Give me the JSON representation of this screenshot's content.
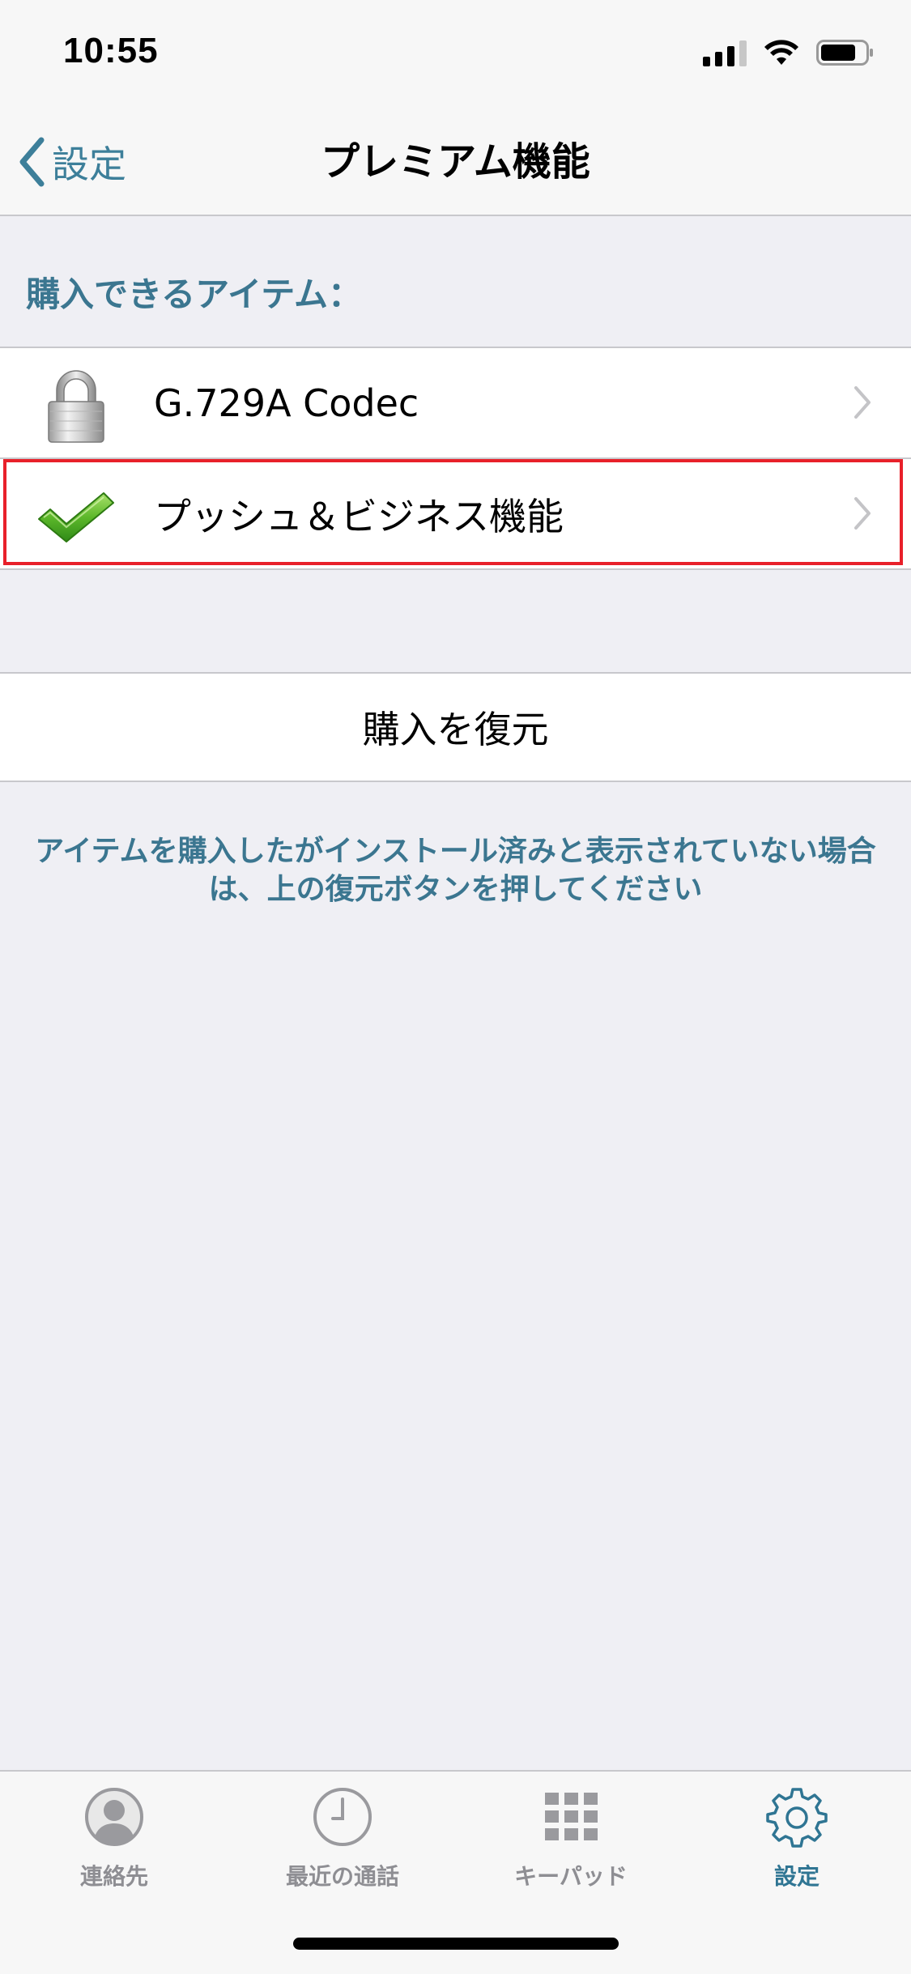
{
  "status_bar": {
    "time": "10:55",
    "icons": [
      "cellular-signal-icon",
      "wifi-icon",
      "battery-icon"
    ]
  },
  "nav": {
    "back_label": "設定",
    "title": "プレミアム機能"
  },
  "section": {
    "header": "購入できるアイテム："
  },
  "items": [
    {
      "label": "G.729A Codec",
      "icon": "lock-icon",
      "status": "locked"
    },
    {
      "label": "プッシュ＆ビジネス機能",
      "icon": "checkmark-icon",
      "status": "installed",
      "highlighted": true
    }
  ],
  "restore": {
    "label": "購入を復元"
  },
  "footer": {
    "note": "アイテムを購入したがインストール済みと表示されていない場合は、上の復元ボタンを押してください"
  },
  "tabs": [
    {
      "label": "連絡先",
      "icon": "contact-icon",
      "active": false
    },
    {
      "label": "最近の通話",
      "icon": "clock-icon",
      "active": false
    },
    {
      "label": "キーパッド",
      "icon": "keypad-icon",
      "active": false
    },
    {
      "label": "設定",
      "icon": "gear-icon",
      "active": true
    }
  ],
  "colors": {
    "accent": "#2f7593",
    "section_text": "#3b7690",
    "highlight_border": "#e8202a",
    "background": "#efeff4"
  }
}
